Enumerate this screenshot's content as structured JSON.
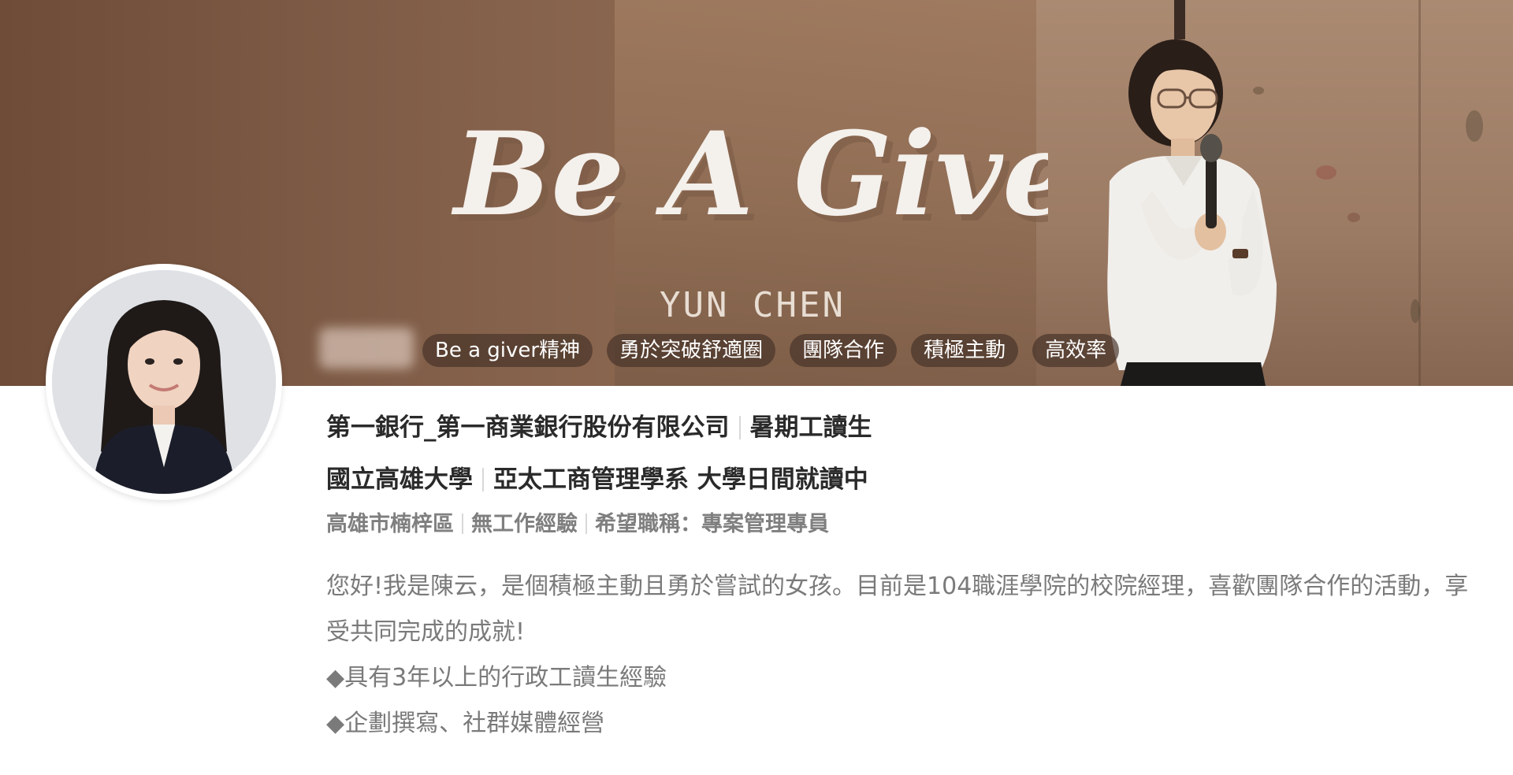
{
  "cover": {
    "title": "Be A Giver",
    "subtitle": "YUN CHEN"
  },
  "skills": [
    "Be a giver精神",
    "勇於突破舒適圈",
    "團隊合作",
    "積極主動",
    "高效率"
  ],
  "job": {
    "company": "第一銀行_第一商業銀行股份有限公司",
    "title": "暑期工讀生"
  },
  "education": {
    "school": "國立高雄大學",
    "department": "亞太工商管理學系 大學日間就讀中"
  },
  "meta": {
    "location": "高雄市楠梓區",
    "experience": "無工作經驗",
    "desired_title": "希望職稱：專案管理專員"
  },
  "about": {
    "intro": "您好!我是陳云，是個積極主動且勇於嘗試的女孩。目前是104職涯學院的校院經理，喜歡團隊合作的活動，享受共同完成的成就!",
    "point_1": "◆具有3年以上的行政工讀生經驗",
    "point_2": "◆企劃撰寫、社群媒體經營"
  },
  "colors": {
    "cover_brown": "#8a6750",
    "chip_bg": "#4a3428",
    "primary_text": "#2a2a2a",
    "secondary_text": "#7f7f7f"
  }
}
